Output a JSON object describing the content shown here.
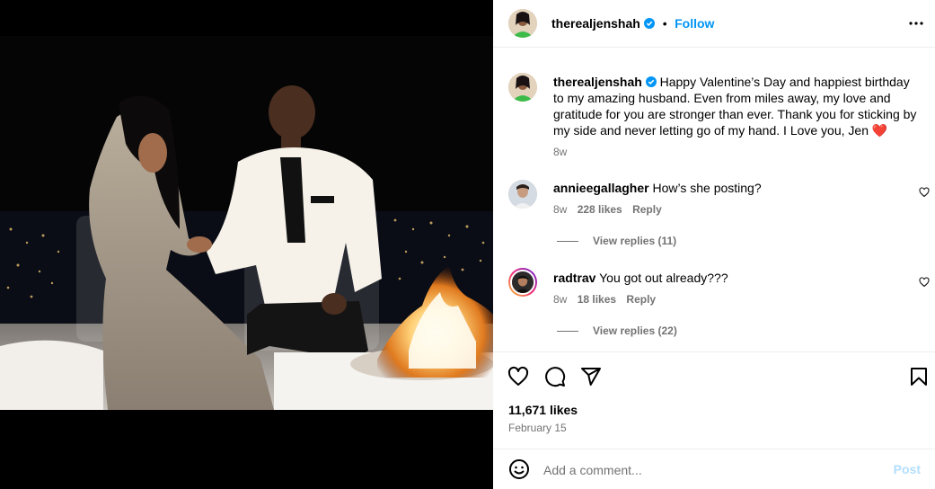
{
  "author": {
    "username": "therealjenshah",
    "follow_label": "Follow",
    "separator": "•"
  },
  "caption": {
    "username": "therealjenshah",
    "text": "Happy Valentine’s Day and happiest birthday to my amazing husband. Even from miles away, my love and gratitude for you are stronger than ever. Thank you for sticking by my side and never letting go of my hand. I Love you, Jen",
    "emoji": "❤️",
    "time": "8w"
  },
  "comments": [
    {
      "username": "annieegallagher",
      "text": "How’s she posting?",
      "time": "8w",
      "likes": "228 likes",
      "reply_label": "Reply",
      "view_replies": "View replies (11)"
    },
    {
      "username": "radtrav",
      "text": "You got out already???",
      "time": "8w",
      "likes": "18 likes",
      "reply_label": "Reply",
      "view_replies": "View replies (22)"
    }
  ],
  "post": {
    "likes": "11,671 likes",
    "date": "February 15"
  },
  "comment_box": {
    "placeholder": "Add a comment...",
    "post_label": "Post"
  },
  "colors": {
    "accent": "#0095f6",
    "secondary_text": "#737373",
    "heart_red": "#ed4956",
    "post_disabled": "#b2dffc"
  },
  "icons": [
    "verified-badge-icon",
    "more-options-icon",
    "like-icon",
    "comment-icon",
    "share-icon",
    "save-icon",
    "emoji-icon"
  ]
}
